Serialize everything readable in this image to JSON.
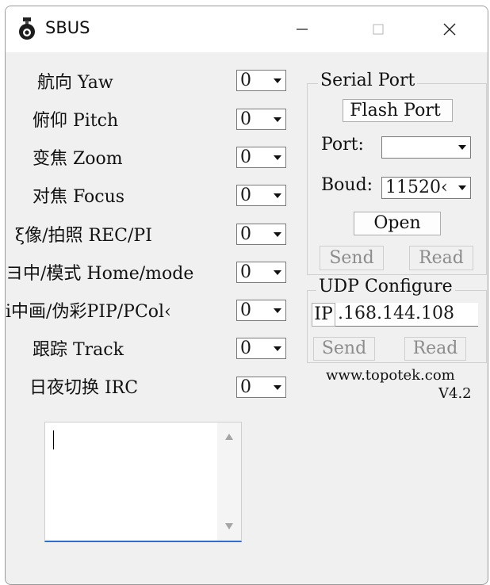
{
  "window": {
    "title": "SBUS",
    "icon": "camera-gimbal-icon",
    "controls": [
      "minimize-icon",
      "maximize-icon",
      "close-icon"
    ]
  },
  "controls": [
    {
      "label": "航向 Yaw",
      "value": "0"
    },
    {
      "label": "俯仰 Pitch",
      "value": "0"
    },
    {
      "label": "变焦 Zoom",
      "value": "0"
    },
    {
      "label": "对焦 Focus",
      "value": "0"
    },
    {
      "label": "ξ像/拍照 REC/PI",
      "value": "0"
    },
    {
      "label": "ヨ中/模式 Home/mode",
      "value": "0"
    },
    {
      "label": "i中画/伪彩PIP/PCol‹",
      "value": "0"
    },
    {
      "label": "跟踪 Track",
      "value": "0"
    },
    {
      "label": "日夜切换 IRC",
      "value": "0"
    }
  ],
  "serial_port": {
    "title": "Serial Port",
    "flash_button": "Flash Port",
    "port_label": "Port:",
    "port_value": "",
    "baud_label": "Boud:",
    "baud_value": "11520‹",
    "open_button": "Open",
    "send_button": "Send",
    "read_button": "Read"
  },
  "udp": {
    "title": "UDP Configure",
    "ip_label": "IP",
    "ip_value": ".168.144.108",
    "send_button": "Send",
    "read_button": "Read"
  },
  "footer": {
    "website": "www.topotek.com",
    "version": "V4.2"
  },
  "log": {
    "text": ""
  },
  "colors": {
    "window_bg": "#f0f0f0",
    "titlebar_bg": "#ffffff",
    "focus_accent": "#2d6dd6",
    "disabled_text": "#8c8c8c"
  }
}
